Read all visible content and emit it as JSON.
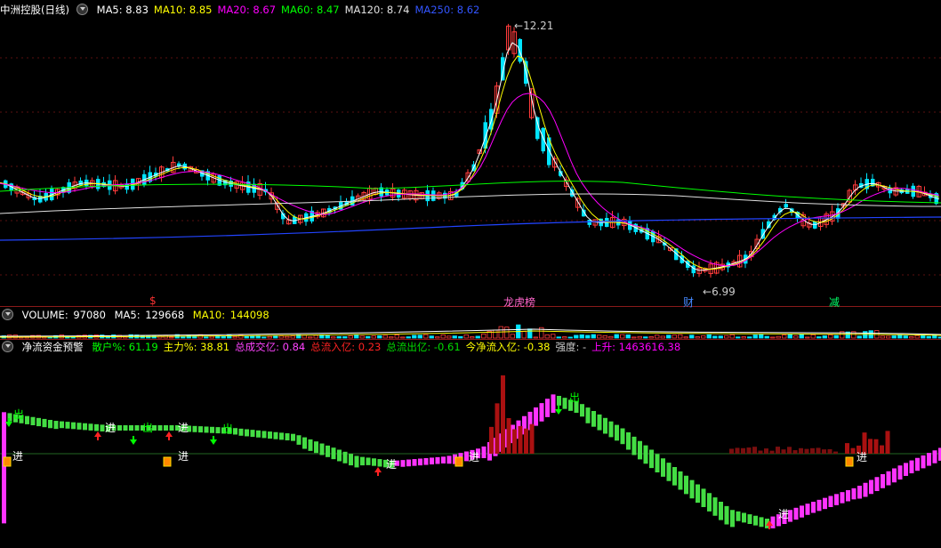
{
  "kline": {
    "title": "中洲控股(日线)",
    "ma": [
      {
        "label": "MA5:",
        "value": "8.83",
        "color": "#ffffff"
      },
      {
        "label": "MA10:",
        "value": "8.85",
        "color": "#ffff00"
      },
      {
        "label": "MA20:",
        "value": "8.67",
        "color": "#ff00ff"
      },
      {
        "label": "MA60:",
        "value": "8.47",
        "color": "#00ff00"
      },
      {
        "label": "MA120:",
        "value": "8.74",
        "color": "#e0e0e0"
      },
      {
        "label": "MA250:",
        "value": "8.62",
        "color": "#3355ff"
      }
    ],
    "high_label": "12.21",
    "low_label": "6.99",
    "markers": [
      {
        "text": "$",
        "color": "#ff3333"
      },
      {
        "text": "龙虎榜",
        "color": "#ff66cc"
      },
      {
        "text": "财",
        "color": "#4488ff"
      },
      {
        "text": "减",
        "color": "#00ff66"
      }
    ]
  },
  "volume": {
    "title": "VOLUME:",
    "value": "97080",
    "ma5_label": "MA5:",
    "ma5": "129668",
    "ma10_label": "MA10:",
    "ma10": "144098"
  },
  "indicator": {
    "title": "净流资金预警",
    "items": [
      {
        "label": "散户%:",
        "value": "61.19",
        "color": "#00ff00"
      },
      {
        "label": "主力%:",
        "value": "38.81",
        "color": "#ffff00"
      },
      {
        "label": "总成交亿:",
        "value": "0.84",
        "color": "#ff44ff"
      },
      {
        "label": "总流入亿:",
        "value": "0.23",
        "color": "#ff2222"
      },
      {
        "label": "总流出亿:",
        "value": "-0.61",
        "color": "#00dd00"
      },
      {
        "label": "今净流入亿:",
        "value": "-0.38",
        "color": "#ffff00"
      },
      {
        "label": "强度:",
        "value": "-",
        "color": "#cccccc"
      },
      {
        "label": "上升:",
        "value": "1463616.38",
        "color": "#ff00ff"
      }
    ],
    "signal_in": "进",
    "signal_out": "出"
  }
}
